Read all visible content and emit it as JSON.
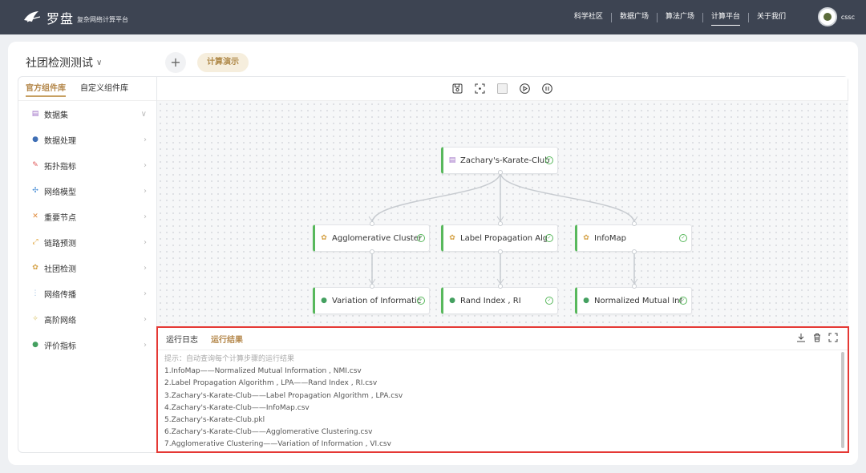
{
  "header": {
    "brand": "罗盘",
    "brand_sub": "复杂网络计算平台",
    "nav": [
      {
        "label": "科学社区"
      },
      {
        "label": "数据广场"
      },
      {
        "label": "算法广场"
      },
      {
        "label": "计算平台",
        "active": true
      },
      {
        "label": "关于我们"
      }
    ],
    "username": "cssc"
  },
  "project": {
    "title": "社团检测测试",
    "add_label": "+",
    "demo_label": "计算演示"
  },
  "sidebar": {
    "tabs": [
      {
        "label": "官方组件库",
        "active": true
      },
      {
        "label": "自定义组件库"
      }
    ],
    "items": [
      {
        "label": "数据集",
        "icon": "dataset-icon",
        "color": "#9c6cc4",
        "glyph": "▤",
        "expanded": true
      },
      {
        "label": "数据处理",
        "icon": "globe-icon",
        "color": "#3f6fb5",
        "glyph": "●"
      },
      {
        "label": "拓扑指标",
        "icon": "topology-icon",
        "color": "#e05a5a",
        "glyph": "✎"
      },
      {
        "label": "网络模型",
        "icon": "network-model-icon",
        "color": "#4a8fd6",
        "glyph": "✣"
      },
      {
        "label": "重要节点",
        "icon": "key-node-icon",
        "color": "#e08a3a",
        "glyph": "✕"
      },
      {
        "label": "链路预测",
        "icon": "link-predict-icon",
        "color": "#e0a030",
        "glyph": "⤢"
      },
      {
        "label": "社团检测",
        "icon": "community-icon",
        "color": "#d4a043",
        "glyph": "✿"
      },
      {
        "label": "网络传播",
        "icon": "spread-icon",
        "color": "#9bbce0",
        "glyph": "⋮"
      },
      {
        "label": "高阶网络",
        "icon": "high-order-icon",
        "color": "#d8c060",
        "glyph": "✧"
      },
      {
        "label": "评价指标",
        "icon": "evaluate-icon",
        "color": "#44a060",
        "glyph": "●"
      }
    ]
  },
  "toolbar": {
    "icons": [
      "save-icon",
      "focus-icon",
      "stop-icon",
      "play-icon",
      "pause-icon"
    ]
  },
  "nodes": {
    "root": {
      "label": "Zachary's-Karate-Club",
      "icon": "dataset-icon"
    },
    "algo1": {
      "label": "Agglomerative Cluster",
      "icon": "community-icon"
    },
    "algo2": {
      "label": "Label Propagation Alg",
      "icon": "community-icon"
    },
    "algo3": {
      "label": "InfoMap",
      "icon": "community-icon"
    },
    "eval1": {
      "label": "Variation of Informatic",
      "icon": "evaluate-icon"
    },
    "eval2": {
      "label": "Rand Index , RI",
      "icon": "evaluate-icon"
    },
    "eval3": {
      "label": "Normalized Mutual Inf",
      "icon": "evaluate-icon"
    }
  },
  "console": {
    "tabs": [
      {
        "label": "运行日志"
      },
      {
        "label": "运行结果",
        "active": true
      }
    ],
    "hint": "提示：自动查询每个计算步骤的运行结果",
    "results": [
      "1.InfoMap——Normalized Mutual Information , NMI.csv",
      "2.Label Propagation Algorithm , LPA——Rand Index , RI.csv",
      "3.Zachary's-Karate-Club——Label Propagation Algorithm , LPA.csv",
      "4.Zachary's-Karate-Club——InfoMap.csv",
      "5.Zachary's-Karate-Club.pkl",
      "6.Zachary's-Karate-Club——Agglomerative Clustering.csv",
      "7.Agglomerative Clustering——Variation of Information , VI.csv"
    ]
  },
  "colors": {
    "accent": "#b4874a",
    "node_border": "#58b85c",
    "highlight": "#e53935"
  }
}
